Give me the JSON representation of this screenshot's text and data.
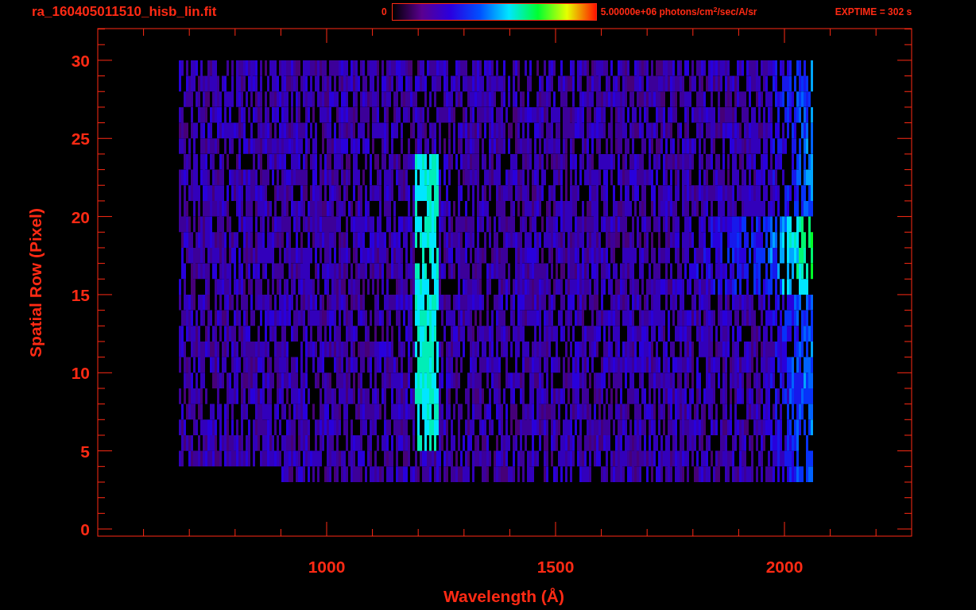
{
  "header": {
    "filename": "ra_160405011510_hisb_lin.fit",
    "colorbar": {
      "min_label": "0",
      "max_label": "5.00000e+06 photons/cm$^{2}$/sec/A/sr"
    },
    "exptime": "EXPTIME = 302 s"
  },
  "plot": {
    "xlabel": "Wavelength (Å)",
    "ylabel": "Spatial Row (Pixel)",
    "xticks": [
      "1000",
      "1500",
      "2000"
    ],
    "yticks": [
      "30",
      "25",
      "20",
      "15",
      "10",
      "5",
      "0"
    ]
  }
}
